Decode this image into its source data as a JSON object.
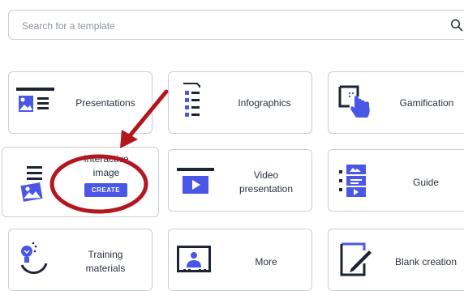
{
  "search": {
    "placeholder": "Search for a template",
    "icon": "search-icon"
  },
  "templates": [
    {
      "label": "Presentations",
      "icon": "presentation-icon"
    },
    {
      "label": "Infographics",
      "icon": "infographic-icon"
    },
    {
      "label": "Gamification",
      "icon": "gamification-icon"
    },
    {
      "label_line1": "Interactive",
      "label_line2": "image",
      "icon": "interactive-image-icon",
      "button": "CREATE"
    },
    {
      "label_line1": "Video",
      "label_line2": "presentation",
      "icon": "video-presentation-icon"
    },
    {
      "label": "Guide",
      "icon": "guide-icon"
    },
    {
      "label_line1": "Training",
      "label_line2": "materials",
      "icon": "training-materials-icon"
    },
    {
      "label": "More",
      "icon": "more-icon"
    },
    {
      "label": "Blank creation",
      "icon": "blank-creation-icon"
    }
  ],
  "colors": {
    "accent": "#4a57e6",
    "icon_dark": "#1d2433",
    "annotation_red": "#b3161e",
    "border": "#c9ced6"
  }
}
